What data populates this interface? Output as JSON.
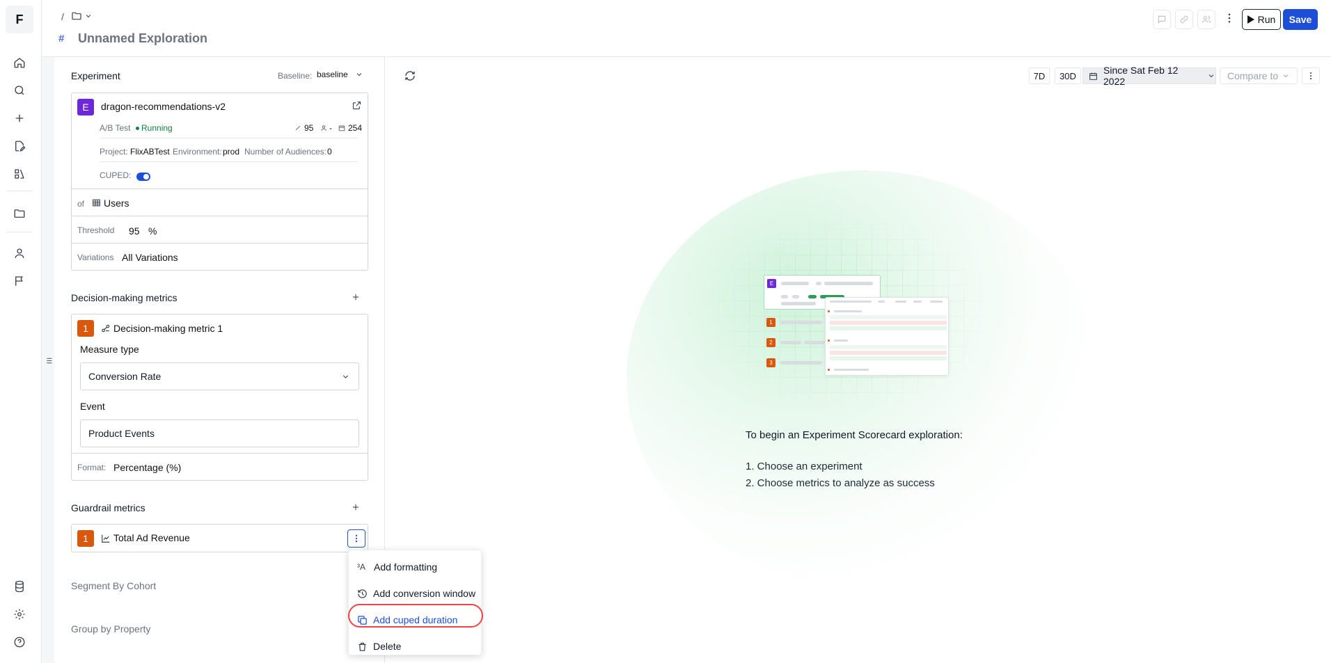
{
  "rail": {
    "logo": "F",
    "icons": [
      "home-icon",
      "search-icon",
      "plus-icon",
      "edit-doc-icon",
      "experiment-icon",
      "folder-icon",
      "user-icon",
      "flag-icon",
      "database-icon",
      "gear-icon",
      "help-icon"
    ]
  },
  "header": {
    "breadcrumb_sep": "/",
    "title": "Unnamed Exploration",
    "run_label": "Run",
    "save_label": "Save"
  },
  "experiment": {
    "section_title": "Experiment",
    "baseline_label": "Baseline:",
    "baseline_value": "baseline",
    "badge": "E",
    "name": "dragon-recommendations-v2",
    "type": "A/B Test",
    "status": "Running",
    "significance": "95",
    "audience": "-",
    "days": "254",
    "project_label": "Project:",
    "project_value": "FlixABTest",
    "env_label": "Environment:",
    "env_value": "prod",
    "audiences_label": "Number of Audiences:",
    "audiences_value": "0",
    "cuped_label": "CUPED:",
    "of_label": "of",
    "of_value": "Users",
    "threshold_label": "Threshold",
    "threshold_value": "95",
    "threshold_unit": "%",
    "variations_label": "Variations",
    "variations_value": "All Variations"
  },
  "decision": {
    "section_title": "Decision-making metrics",
    "badge": "1",
    "metric_name": "Decision-making metric 1",
    "measure_label": "Measure type",
    "measure_value": "Conversion Rate",
    "event_label": "Event",
    "event_value": "Product Events",
    "format_label": "Format:",
    "format_value": "Percentage (%)"
  },
  "guardrail": {
    "section_title": "Guardrail metrics",
    "badge": "1",
    "metric_name": "Total Ad Revenue"
  },
  "segment_label": "Segment By Cohort",
  "group_label": "Group by Property",
  "menu": {
    "items": [
      "Add formatting",
      "Add conversion window",
      "Add cuped duration",
      "Delete"
    ]
  },
  "toolbar": {
    "range_7d": "7D",
    "range_30d": "30D",
    "since": "Since Sat Feb 12 2022",
    "compare": "Compare to"
  },
  "empty_state": {
    "title": "To begin an Experiment Scorecard exploration:",
    "step1": "1. Choose an experiment",
    "step2": "2. Choose metrics to analyze as success",
    "preview_badges": [
      "E",
      "1",
      "2",
      "3"
    ]
  },
  "colors": {
    "accent": "#1d4ed8",
    "running": "#15803d",
    "badge_purple": "#6d28d9",
    "badge_orange": "#d9580e",
    "highlight_ring": "#ef4444"
  }
}
